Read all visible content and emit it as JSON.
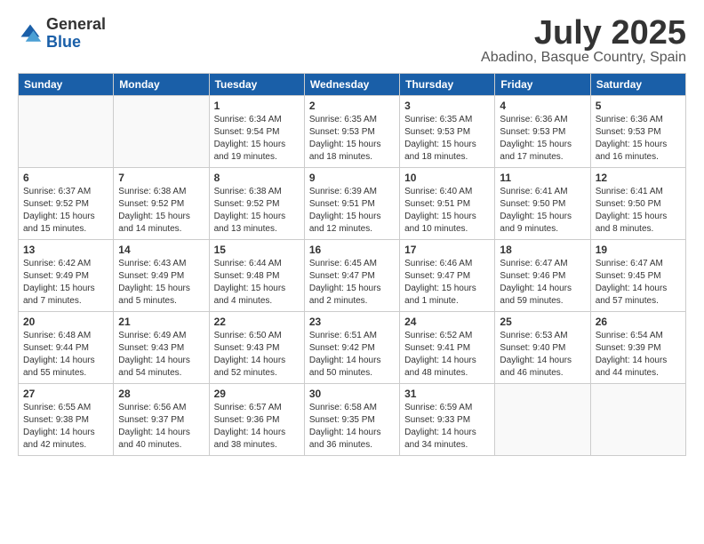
{
  "logo": {
    "general": "General",
    "blue": "Blue"
  },
  "header": {
    "month": "July 2025",
    "location": "Abadino, Basque Country, Spain"
  },
  "weekdays": [
    "Sunday",
    "Monday",
    "Tuesday",
    "Wednesday",
    "Thursday",
    "Friday",
    "Saturday"
  ],
  "weeks": [
    [
      {
        "day": "",
        "content": ""
      },
      {
        "day": "",
        "content": ""
      },
      {
        "day": "1",
        "content": "Sunrise: 6:34 AM\nSunset: 9:54 PM\nDaylight: 15 hours\nand 19 minutes."
      },
      {
        "day": "2",
        "content": "Sunrise: 6:35 AM\nSunset: 9:53 PM\nDaylight: 15 hours\nand 18 minutes."
      },
      {
        "day": "3",
        "content": "Sunrise: 6:35 AM\nSunset: 9:53 PM\nDaylight: 15 hours\nand 18 minutes."
      },
      {
        "day": "4",
        "content": "Sunrise: 6:36 AM\nSunset: 9:53 PM\nDaylight: 15 hours\nand 17 minutes."
      },
      {
        "day": "5",
        "content": "Sunrise: 6:36 AM\nSunset: 9:53 PM\nDaylight: 15 hours\nand 16 minutes."
      }
    ],
    [
      {
        "day": "6",
        "content": "Sunrise: 6:37 AM\nSunset: 9:52 PM\nDaylight: 15 hours\nand 15 minutes."
      },
      {
        "day": "7",
        "content": "Sunrise: 6:38 AM\nSunset: 9:52 PM\nDaylight: 15 hours\nand 14 minutes."
      },
      {
        "day": "8",
        "content": "Sunrise: 6:38 AM\nSunset: 9:52 PM\nDaylight: 15 hours\nand 13 minutes."
      },
      {
        "day": "9",
        "content": "Sunrise: 6:39 AM\nSunset: 9:51 PM\nDaylight: 15 hours\nand 12 minutes."
      },
      {
        "day": "10",
        "content": "Sunrise: 6:40 AM\nSunset: 9:51 PM\nDaylight: 15 hours\nand 10 minutes."
      },
      {
        "day": "11",
        "content": "Sunrise: 6:41 AM\nSunset: 9:50 PM\nDaylight: 15 hours\nand 9 minutes."
      },
      {
        "day": "12",
        "content": "Sunrise: 6:41 AM\nSunset: 9:50 PM\nDaylight: 15 hours\nand 8 minutes."
      }
    ],
    [
      {
        "day": "13",
        "content": "Sunrise: 6:42 AM\nSunset: 9:49 PM\nDaylight: 15 hours\nand 7 minutes."
      },
      {
        "day": "14",
        "content": "Sunrise: 6:43 AM\nSunset: 9:49 PM\nDaylight: 15 hours\nand 5 minutes."
      },
      {
        "day": "15",
        "content": "Sunrise: 6:44 AM\nSunset: 9:48 PM\nDaylight: 15 hours\nand 4 minutes."
      },
      {
        "day": "16",
        "content": "Sunrise: 6:45 AM\nSunset: 9:47 PM\nDaylight: 15 hours\nand 2 minutes."
      },
      {
        "day": "17",
        "content": "Sunrise: 6:46 AM\nSunset: 9:47 PM\nDaylight: 15 hours\nand 1 minute."
      },
      {
        "day": "18",
        "content": "Sunrise: 6:47 AM\nSunset: 9:46 PM\nDaylight: 14 hours\nand 59 minutes."
      },
      {
        "day": "19",
        "content": "Sunrise: 6:47 AM\nSunset: 9:45 PM\nDaylight: 14 hours\nand 57 minutes."
      }
    ],
    [
      {
        "day": "20",
        "content": "Sunrise: 6:48 AM\nSunset: 9:44 PM\nDaylight: 14 hours\nand 55 minutes."
      },
      {
        "day": "21",
        "content": "Sunrise: 6:49 AM\nSunset: 9:43 PM\nDaylight: 14 hours\nand 54 minutes."
      },
      {
        "day": "22",
        "content": "Sunrise: 6:50 AM\nSunset: 9:43 PM\nDaylight: 14 hours\nand 52 minutes."
      },
      {
        "day": "23",
        "content": "Sunrise: 6:51 AM\nSunset: 9:42 PM\nDaylight: 14 hours\nand 50 minutes."
      },
      {
        "day": "24",
        "content": "Sunrise: 6:52 AM\nSunset: 9:41 PM\nDaylight: 14 hours\nand 48 minutes."
      },
      {
        "day": "25",
        "content": "Sunrise: 6:53 AM\nSunset: 9:40 PM\nDaylight: 14 hours\nand 46 minutes."
      },
      {
        "day": "26",
        "content": "Sunrise: 6:54 AM\nSunset: 9:39 PM\nDaylight: 14 hours\nand 44 minutes."
      }
    ],
    [
      {
        "day": "27",
        "content": "Sunrise: 6:55 AM\nSunset: 9:38 PM\nDaylight: 14 hours\nand 42 minutes."
      },
      {
        "day": "28",
        "content": "Sunrise: 6:56 AM\nSunset: 9:37 PM\nDaylight: 14 hours\nand 40 minutes."
      },
      {
        "day": "29",
        "content": "Sunrise: 6:57 AM\nSunset: 9:36 PM\nDaylight: 14 hours\nand 38 minutes."
      },
      {
        "day": "30",
        "content": "Sunrise: 6:58 AM\nSunset: 9:35 PM\nDaylight: 14 hours\nand 36 minutes."
      },
      {
        "day": "31",
        "content": "Sunrise: 6:59 AM\nSunset: 9:33 PM\nDaylight: 14 hours\nand 34 minutes."
      },
      {
        "day": "",
        "content": ""
      },
      {
        "day": "",
        "content": ""
      }
    ]
  ]
}
